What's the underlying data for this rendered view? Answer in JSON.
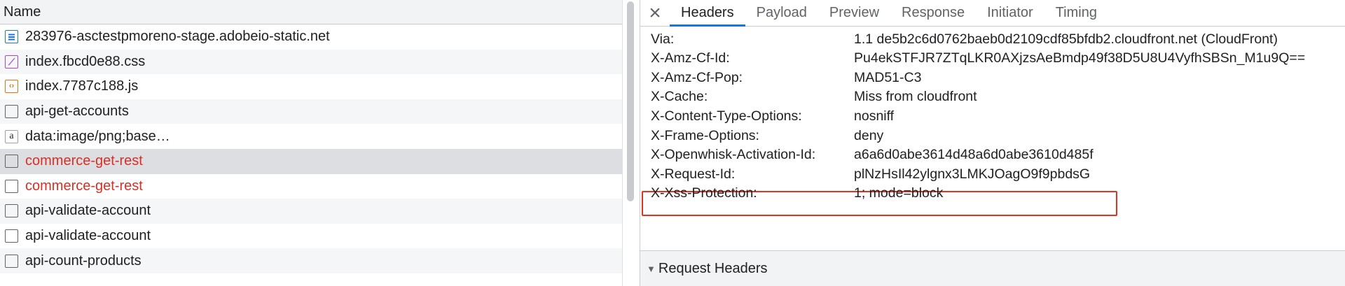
{
  "request_list": {
    "column_header": "Name",
    "rows": [
      {
        "name": "283976-asctestpmoreno-stage.adobeio-static.net",
        "icon": "document-icon",
        "error": false,
        "selected": false
      },
      {
        "name": "index.fbcd0e88.css",
        "icon": "css-file-icon",
        "error": false,
        "selected": false
      },
      {
        "name": "index.7787c188.js",
        "icon": "js-file-icon",
        "error": false,
        "selected": false
      },
      {
        "name": "api-get-accounts",
        "icon": "fetch-icon",
        "error": false,
        "selected": false
      },
      {
        "name": "data:image/png;base…",
        "icon": "image-data-icon",
        "error": false,
        "selected": false
      },
      {
        "name": "commerce-get-rest",
        "icon": "fetch-icon",
        "error": true,
        "selected": true
      },
      {
        "name": "commerce-get-rest",
        "icon": "fetch-icon",
        "error": true,
        "selected": false
      },
      {
        "name": "api-validate-account",
        "icon": "fetch-icon",
        "error": false,
        "selected": false
      },
      {
        "name": "api-validate-account",
        "icon": "fetch-icon",
        "error": false,
        "selected": false
      },
      {
        "name": "api-count-products",
        "icon": "fetch-icon",
        "error": false,
        "selected": false
      }
    ]
  },
  "details": {
    "close_icon": "close-icon",
    "tabs": [
      {
        "label": "Headers",
        "active": true
      },
      {
        "label": "Payload",
        "active": false
      },
      {
        "label": "Preview",
        "active": false
      },
      {
        "label": "Response",
        "active": false
      },
      {
        "label": "Initiator",
        "active": false
      },
      {
        "label": "Timing",
        "active": false
      }
    ],
    "response_headers": [
      {
        "key": "Via:",
        "value": "1.1 de5b2c6d0762baeb0d2109cdf85bfdb2.cloudfront.net (CloudFront)"
      },
      {
        "key": "X-Amz-Cf-Id:",
        "value": "Pu4ekSTFJR7ZTqLKR0AXjzsAeBmdp49f38D5U8U4VyfhSBSn_M1u9Q=="
      },
      {
        "key": "X-Amz-Cf-Pop:",
        "value": "MAD51-C3"
      },
      {
        "key": "X-Cache:",
        "value": "Miss from cloudfront"
      },
      {
        "key": "X-Content-Type-Options:",
        "value": "nosniff"
      },
      {
        "key": "X-Frame-Options:",
        "value": "deny"
      },
      {
        "key": "X-Openwhisk-Activation-Id:",
        "value": "a6a6d0abe3614d48a6d0abe3610d485f",
        "highlighted": true
      },
      {
        "key": "X-Request-Id:",
        "value": "plNzHsIl42ylgnx3LMKJOagO9f9pbdsG"
      },
      {
        "key": "X-Xss-Protection:",
        "value": "1; mode=block"
      }
    ],
    "request_headers_section": {
      "label": "Request Headers",
      "expanded": false
    }
  },
  "colors": {
    "accent": "#1a73e8",
    "error_text": "#d93025",
    "highlight_border": "#e0341e",
    "selected_row": "#dcdee2"
  }
}
